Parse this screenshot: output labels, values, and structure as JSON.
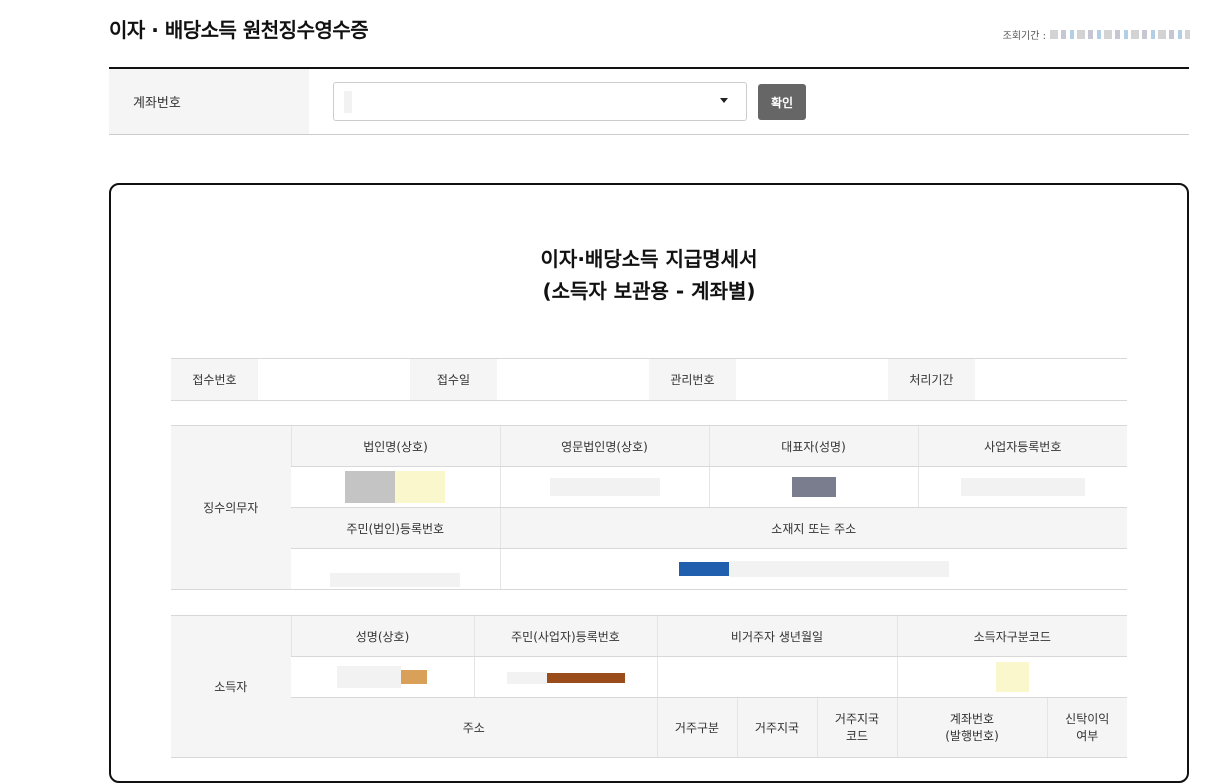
{
  "page": {
    "title": "이자 · 배당소득 원천징수영수증",
    "period_label": "조회기간 :"
  },
  "account": {
    "label": "계좌번호",
    "confirm": "확인"
  },
  "document": {
    "title_line1": "이자·배당소득 지급명세서",
    "title_line2": "(소득자 보관용 - 계좌별)",
    "receipt": {
      "no_label": "접수번호",
      "date_label": "접수일",
      "mgmt_label": "관리번호",
      "period_label": "처리기간"
    },
    "withholder": {
      "section_label": "징수의무자",
      "corp_name": "법인명(상호)",
      "eng_corp_name": "영문법인명(상호)",
      "representative": "대표자(성명)",
      "biz_reg_no": "사업자등록번호",
      "resident_no": "주민(법인)등록번호",
      "address": "소재지 또는 주소"
    },
    "earner": {
      "section_label": "소득자",
      "name": "성명(상호)",
      "resident_no": "주민(사업자)등록번호",
      "nonresident_birth": "비거주자 생년월일",
      "earner_code": "소득자구분코드",
      "address": "주소",
      "residence_type": "거주구분",
      "residence_country": "거주지국",
      "residence_country_code": "거주지국\n코드",
      "account_no": "계좌번호\n(발행번호)",
      "trust_income": "신탁이익\n여부"
    }
  },
  "colors": {
    "redaction_gray": "#c4c4c4",
    "redaction_yellow": "#fbf7cc",
    "redaction_slate": "#7a7d8e",
    "redaction_blue": "#1f5fae",
    "redaction_orange": "#d9a05a",
    "redaction_brown": "#9a4d1a",
    "redaction_light": "#f2f2f2"
  }
}
